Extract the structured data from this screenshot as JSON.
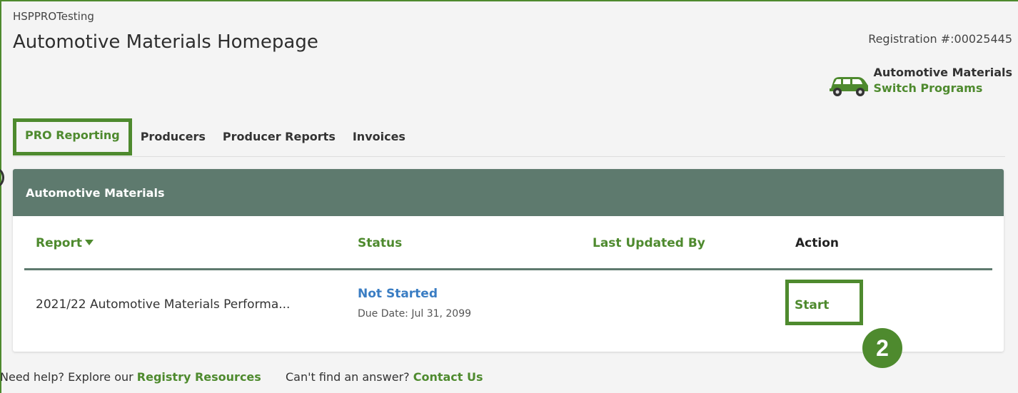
{
  "header": {
    "org_name": "HSPPROTesting",
    "page_title": "Automotive Materials Homepage",
    "registration": "Registration #:00025445",
    "program_name": "Automotive Materials",
    "switch_programs": "Switch Programs"
  },
  "tabs": [
    {
      "label": "PRO Reporting",
      "active": true
    },
    {
      "label": "Producers"
    },
    {
      "label": "Producer Reports"
    },
    {
      "label": "Invoices"
    }
  ],
  "card": {
    "title": "Automotive Materials",
    "columns": {
      "report": "Report",
      "status": "Status",
      "last_updated": "Last Updated By",
      "action": "Action"
    },
    "rows": [
      {
        "report": "2021/22 Automotive Materials Performa...",
        "status": "Not Started",
        "due": "Due Date: Jul 31, 2099",
        "last_updated": "",
        "action": "Start"
      }
    ]
  },
  "step_badge": "2",
  "footer": {
    "help_text": "Need help? Explore our",
    "resources_link": "Registry Resources",
    "answer_text": "Can't find an answer?",
    "contact_link": "Contact Us"
  },
  "colors": {
    "accent": "#4e8a2e",
    "card_header": "#5e7a6e",
    "status_link": "#3a7dc3"
  },
  "icons": {
    "program": "car-icon",
    "sort": "caret-down-icon"
  }
}
